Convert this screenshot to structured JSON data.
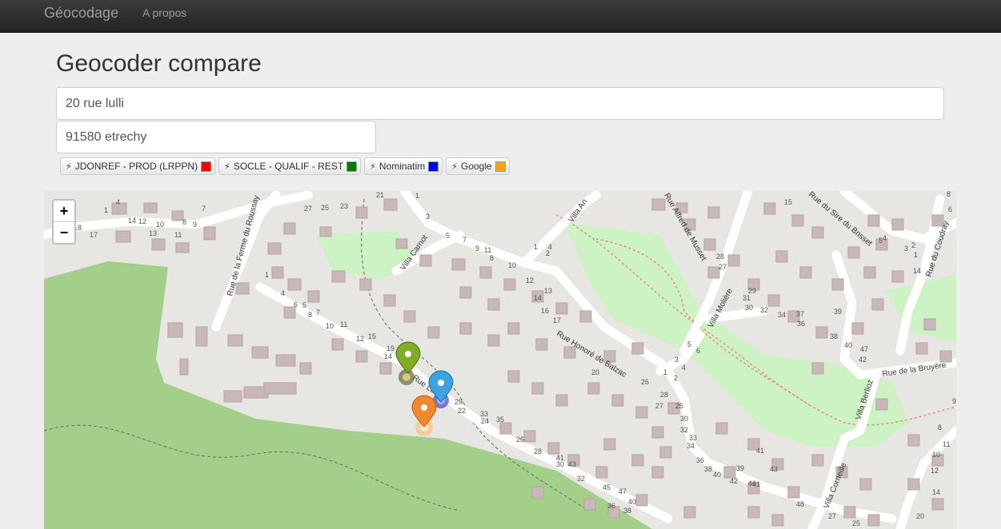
{
  "nav": {
    "brand": "Géocodage",
    "about": "A propos"
  },
  "page": {
    "title": "Geocoder compare"
  },
  "form": {
    "address_value": "20 rue lulli",
    "city_value": "91580 etrechy"
  },
  "geocoders": [
    {
      "label": "JDONREF - PROD (LRPPN)",
      "color": "#ff0000"
    },
    {
      "label": "SOCLE - QUALIF - REST",
      "color": "#007a00"
    },
    {
      "label": "Nominatim",
      "color": "#0000ff"
    },
    {
      "label": "Google",
      "color": "#ffa500"
    }
  ],
  "map": {
    "zoom_in": "+",
    "zoom_out": "−",
    "street_labels": [
      "Rue de la Ferme du Roussay",
      "Villa Carnot",
      "Rue Honoré de Balzac",
      "Rue Alfred de Musset",
      "Villa Molière",
      "Rue du Sire du Brisset",
      "Rue du Coudray",
      "Rue de la Bruyère",
      "Villa Berlioz",
      "Villa Corneille",
      "Villa An",
      "Rue Lulli"
    ],
    "markers": [
      {
        "icon": "map-marker-icon",
        "color": "#7fad2a"
      },
      {
        "icon": "map-marker-icon",
        "color": "#3ba3e0"
      },
      {
        "icon": "map-marker-icon",
        "color": "#f0892d"
      }
    ]
  }
}
